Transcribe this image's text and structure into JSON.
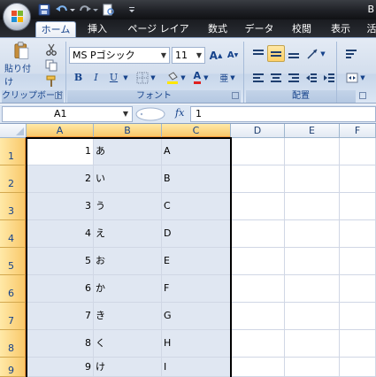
{
  "titlebar": {
    "title_char": "B"
  },
  "tabs": [
    {
      "label": "ホーム",
      "active": true
    },
    {
      "label": "挿入",
      "active": false
    },
    {
      "label": "ページ レイアウト",
      "active": false
    },
    {
      "label": "数式",
      "active": false
    },
    {
      "label": "データ",
      "active": false
    },
    {
      "label": "校閲",
      "active": false
    },
    {
      "label": "表示",
      "active": false
    },
    {
      "label": "活",
      "active": false
    }
  ],
  "ribbon": {
    "clipboard": {
      "paste_label": "貼り付け",
      "group_label": "クリップボード"
    },
    "font": {
      "font_name": "MS Pゴシック",
      "font_size": "11",
      "bold": "B",
      "italic": "I",
      "underline": "U",
      "grow": "A",
      "shrink": "A",
      "font_color_glyph": "A",
      "phonetic": "亜",
      "group_label": "フォント"
    },
    "alignment": {
      "group_label": "配置"
    }
  },
  "formula_bar": {
    "name_box": "A1",
    "fx": "fx",
    "value": "1"
  },
  "grid": {
    "columns": [
      "A",
      "B",
      "C",
      "D",
      "E",
      "F"
    ],
    "selected_columns": [
      "A",
      "B",
      "C"
    ],
    "rows": [
      {
        "row": "1",
        "a": "1",
        "b": "あ",
        "c": "A"
      },
      {
        "row": "2",
        "a": "2",
        "b": "い",
        "c": "B"
      },
      {
        "row": "3",
        "a": "3",
        "b": "う",
        "c": "C"
      },
      {
        "row": "4",
        "a": "4",
        "b": "え",
        "c": "D"
      },
      {
        "row": "5",
        "a": "5",
        "b": "お",
        "c": "E"
      },
      {
        "row": "6",
        "a": "6",
        "b": "か",
        "c": "F"
      },
      {
        "row": "7",
        "a": "7",
        "b": "き",
        "c": "G"
      },
      {
        "row": "8",
        "a": "8",
        "b": "く",
        "c": "H"
      },
      {
        "row": "9",
        "a": "9",
        "b": "け",
        "c": "I"
      }
    ]
  },
  "colors": {
    "accent_header": "#f9c86a",
    "selection_fill": "#e0e7f2",
    "ribbon_text": "#15428b"
  },
  "icons": {
    "office_button": "office-logo-icon",
    "save": "save-icon",
    "undo": "undo-icon",
    "redo": "redo-icon",
    "cut": "scissors-icon",
    "copy": "copy-icon",
    "format_painter": "brush-icon"
  }
}
